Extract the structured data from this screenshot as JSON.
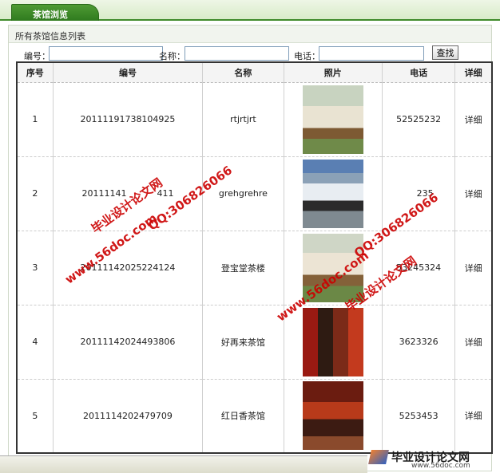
{
  "tab": {
    "label": "茶馆浏览"
  },
  "panel": {
    "caption": "所有茶馆信息列表"
  },
  "search": {
    "id_label": "编号：",
    "name_label": "名称：",
    "phone_label": "电话：",
    "id_value": "",
    "name_value": "",
    "phone_value": "",
    "button_label": "查找"
  },
  "table": {
    "headers": [
      "序号",
      "编号",
      "名称",
      "照片",
      "电话",
      "详细"
    ],
    "rows": [
      {
        "seq": "1",
        "code": "20111191738104925",
        "name": "rtjrtjrt",
        "photo": "teahouse-courtyard-photo",
        "phone": "52525232",
        "detail": "详细"
      },
      {
        "seq": "2",
        "code": "20111141",
        "code_tail": "411",
        "name": "grehgrehre",
        "photo": "mountain-clouds-photo",
        "phone": "235",
        "detail": "详细"
      },
      {
        "seq": "3",
        "code": "20111142025224124",
        "name": "登宝堂茶楼",
        "photo": "teahouse-courtyard-photo",
        "phone": "53245324",
        "detail": "详细"
      },
      {
        "seq": "4",
        "code": "20111142024493806",
        "name": "好再来茶馆",
        "photo": "teahouse-interior-red-photo",
        "phone": "3623326",
        "detail": "详细"
      },
      {
        "seq": "5",
        "code": "2011114202479709",
        "name": "红日香茶馆",
        "photo": "teahouse-hall-red-photo",
        "phone": "5253453",
        "detail": "详细"
      }
    ]
  },
  "watermarks": {
    "site_url": "www.56doc.com",
    "qq": "QQ:306826066",
    "brand": "毕业设计论文网"
  },
  "logo": {
    "text": "毕业设计论文网",
    "url": "www.56doc.com"
  },
  "colors": {
    "accent_green": "#3f8a2a",
    "watermark_red": "#cc0000"
  }
}
